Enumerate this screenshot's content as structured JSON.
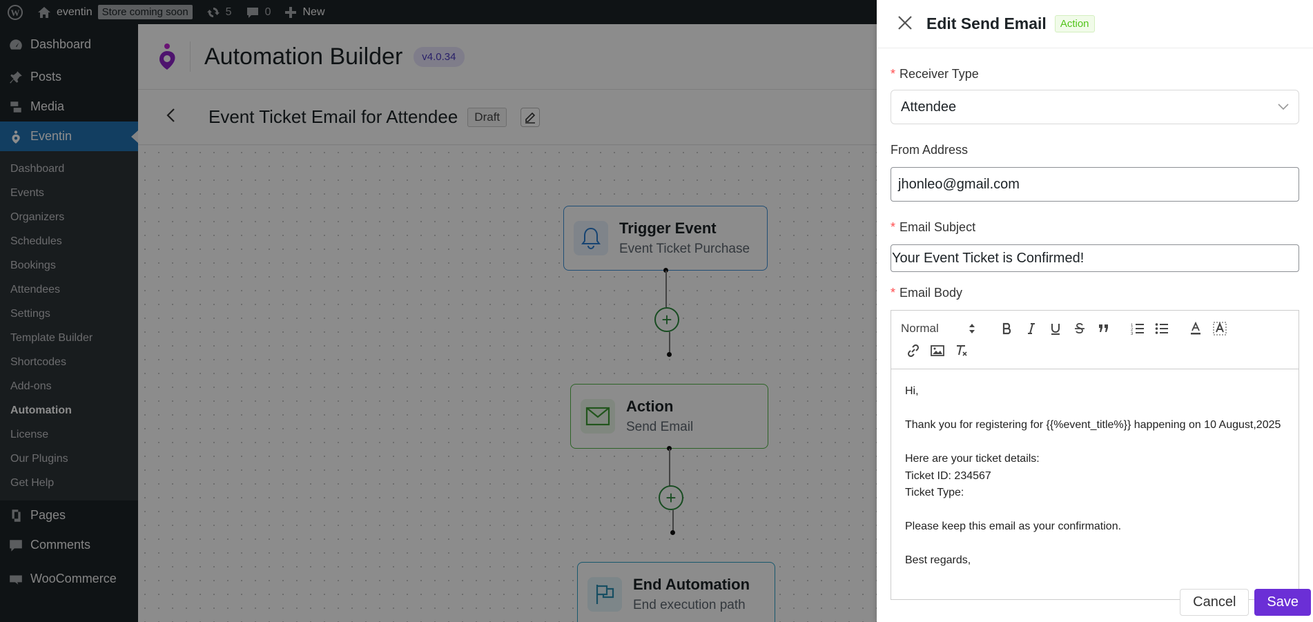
{
  "adminbar": {
    "site_name": "eventin",
    "store_badge": "Store coming soon",
    "updates_count": "5",
    "comments_count": "0",
    "new_label": "New"
  },
  "sidebar": {
    "top_items": [
      {
        "label": "Dashboard",
        "icon": "dashboard-icon"
      },
      {
        "label": "Posts",
        "icon": "pin-icon"
      },
      {
        "label": "Media",
        "icon": "media-icon"
      },
      {
        "label": "Eventin",
        "icon": "eventin-icon",
        "active": true
      }
    ],
    "submenu": [
      "Dashboard",
      "Events",
      "Organizers",
      "Schedules",
      "Bookings",
      "Attendees",
      "Settings",
      "Template Builder",
      "Shortcodes",
      "Add-ons",
      "Automation",
      "License",
      "Our Plugins",
      "Get Help"
    ],
    "current_submenu": "Automation",
    "bottom_items": [
      {
        "label": "Pages",
        "icon": "pages-icon"
      },
      {
        "label": "Comments",
        "icon": "comments-icon"
      },
      {
        "label": "WooCommerce",
        "icon": "woocommerce-icon"
      }
    ]
  },
  "main": {
    "title": "Automation Builder",
    "version": "v4.0.34",
    "workflow_title": "Event Ticket Email for Attendee",
    "status": "Draft",
    "nodes": {
      "trigger": {
        "title": "Trigger Event",
        "subtitle": "Event Ticket Purchase"
      },
      "action": {
        "title": "Action",
        "subtitle": "Send Email"
      },
      "end": {
        "title": "End Automation",
        "subtitle": "End execution path"
      }
    }
  },
  "drawer": {
    "title": "Edit Send Email",
    "tag": "Action",
    "receiver_type_label": "Receiver Type",
    "receiver_type_value": "Attendee",
    "from_address_label": "From Address",
    "from_address_value": "jhonleo@gmail.com",
    "email_subject_label": "Email Subject",
    "email_subject_value": "Your Event Ticket is Confirmed!",
    "email_body_label": "Email Body",
    "toolbar": {
      "heading_select": "Normal"
    },
    "body_lines": [
      "Hi,",
      "",
      "Thank you for registering for {{%event_title%}} happening on 10 August,2025",
      "",
      "Here are your ticket details:",
      "Ticket ID: 234567",
      "Ticket Type:",
      "",
      "Please keep this email as your confirmation.",
      "",
      "Best regards,"
    ],
    "cancel_label": "Cancel",
    "save_label": "Save"
  },
  "colors": {
    "wp_dark": "#1d2327",
    "wp_blue": "#2271b1",
    "accent_purple": "#6b2fd6",
    "trigger_border": "#3b8fd6",
    "action_border": "#52b548",
    "end_border": "#2aa0c7"
  }
}
